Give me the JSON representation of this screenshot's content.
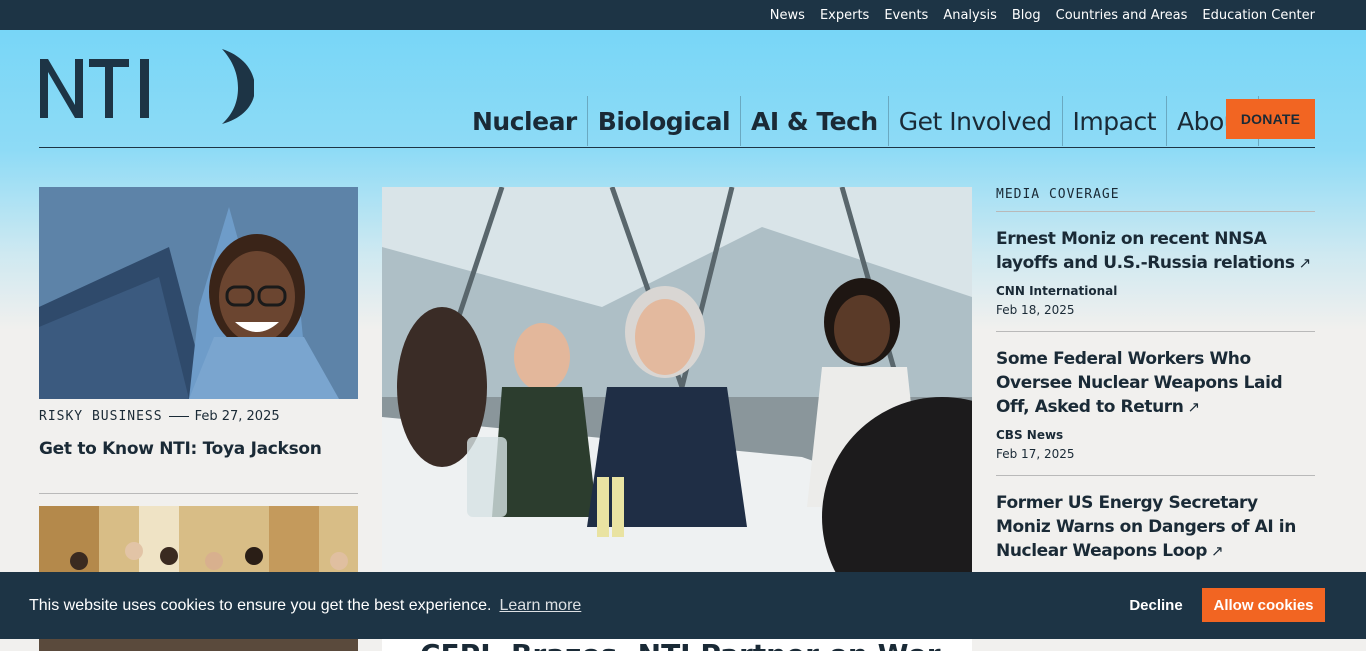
{
  "top_nav": [
    "News",
    "Experts",
    "Events",
    "Analysis",
    "Blog",
    "Countries and Areas",
    "Education Center"
  ],
  "logo": {
    "text": "NTI"
  },
  "main_nav": [
    {
      "label": "Nuclear",
      "bold": true
    },
    {
      "label": "Biological",
      "bold": true
    },
    {
      "label": "AI & Tech",
      "bold": true
    },
    {
      "label": "Get Involved",
      "bold": false
    },
    {
      "label": "Impact",
      "bold": false
    },
    {
      "label": "About",
      "bold": false
    }
  ],
  "donate_label": "DONATE",
  "card1": {
    "category": "RISKY BUSINESS",
    "date": "Feb 27, 2025",
    "title": "Get to Know NTI: Toya Jackson"
  },
  "feature": {
    "title_partial": "CEPI, Brazos, NTI Partner on Wor"
  },
  "media": {
    "heading": "MEDIA COVERAGE",
    "items": [
      {
        "title": "Ernest Moniz on recent NNSA layoffs and U.S.-Russia relations",
        "source": "CNN International",
        "date": "Feb 18, 2025"
      },
      {
        "title": "Some Federal Workers Who Oversee Nuclear Weapons Laid Off, Asked to Return",
        "source": "CBS News",
        "date": "Feb 17, 2025"
      },
      {
        "title": "Former US Energy Secretary Moniz Warns on Dangers of AI in Nuclear Weapons Loop",
        "source": "",
        "date": ""
      }
    ]
  },
  "cookie": {
    "message": "This website uses cookies to ensure you get the best experience.",
    "learn_more": "Learn more",
    "decline": "Decline",
    "allow": "Allow cookies"
  },
  "colors": {
    "topbar": "#1d3445",
    "sky": "#78d6f7",
    "accent": "#f26522",
    "ink": "#1a2a36"
  }
}
